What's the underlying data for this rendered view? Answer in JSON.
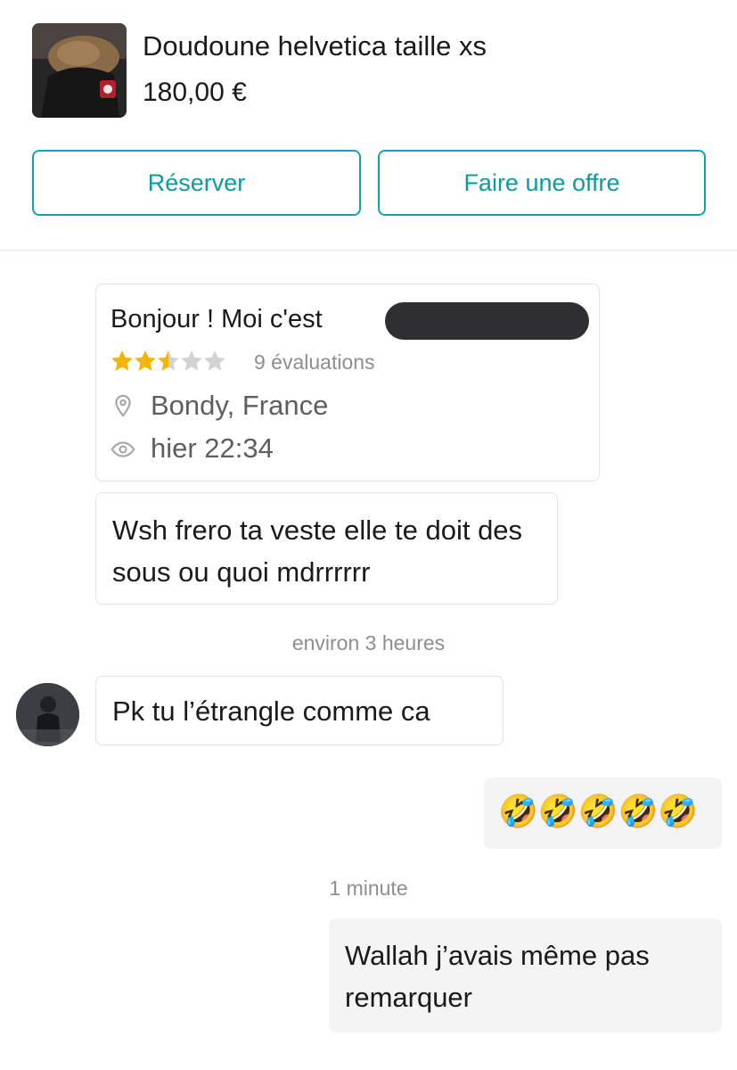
{
  "item": {
    "title": "Doudoune helvetica taille xs",
    "price": "180,00 €"
  },
  "actions": {
    "reserve_label": "Réserver",
    "offer_label": "Faire une offre"
  },
  "profile": {
    "greeting": "Bonjour ! Moi c'est",
    "rating": 2.5,
    "rating_max": 5,
    "reviews": "9 évaluations",
    "location": "Bondy, France",
    "last_seen": "hier 22:34",
    "colors": {
      "star_filled": "#f5b400",
      "star_empty": "#d3d3d3"
    }
  },
  "messages": [
    {
      "from": "them",
      "text": "Wsh frero ta veste elle te doit des sous ou quoi mdrrrrrr"
    },
    {
      "timestamp": "environ 3 heures"
    },
    {
      "from": "them",
      "text": "Pk tu l’étrangle comme ca"
    },
    {
      "from": "me",
      "text": "🤣🤣🤣🤣🤣"
    },
    {
      "timestamp": "1 minute"
    },
    {
      "from": "me",
      "text": "Wallah j’avais même pas remarquer"
    }
  ],
  "accent_color": "#12a5a9"
}
